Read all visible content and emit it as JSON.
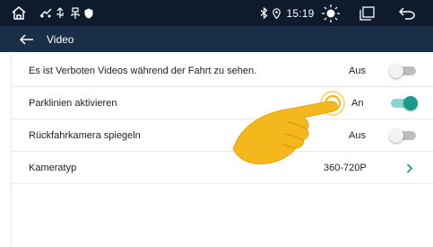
{
  "status_bar": {
    "time": "15:19",
    "icons": [
      "home-icon",
      "usb-icon",
      "usb-storage-icon",
      "shield-icon",
      "bluetooth-icon",
      "location-icon",
      "brightness-icon",
      "recent-apps-icon",
      "back-icon"
    ]
  },
  "app_bar": {
    "title": "Video"
  },
  "settings": [
    {
      "label": "Es ist Verboten Videos während der Fahrt zu sehen.",
      "value": "Aus",
      "control": "toggle",
      "on": false
    },
    {
      "label": "Parklinien aktivieren",
      "value": "An",
      "control": "toggle",
      "on": true
    },
    {
      "label": "Rückfahrkamera spiegeln",
      "value": "Aus",
      "control": "toggle",
      "on": false
    },
    {
      "label": "Kameratyp",
      "value": "360-720P",
      "control": "chevron"
    }
  ],
  "colors": {
    "status_bar_bg": "#0e1b2c",
    "app_bar_bg": "#1b2e47",
    "accent": "#1a9a8a",
    "hand": "#f5b81c"
  }
}
